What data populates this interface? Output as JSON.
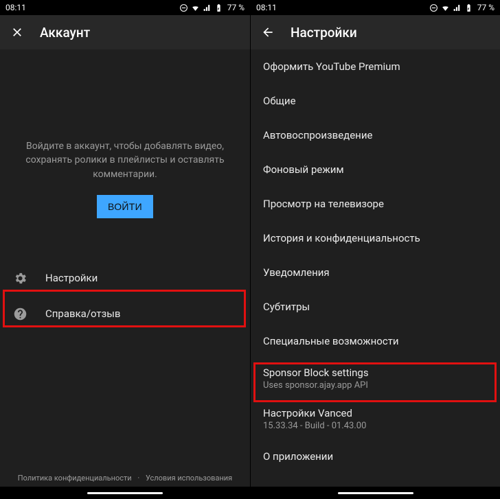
{
  "statusbar": {
    "time": "08:11",
    "battery_text": "77 %"
  },
  "left": {
    "title": "Аккаунт",
    "signin_text": "Войдите в аккаунт, чтобы добавлять видео, сохранять ролики в плейлисты и оставлять комментарии.",
    "signin_button": "ВОЙТИ",
    "items": [
      {
        "label": "Настройки"
      },
      {
        "label": "Справка/отзыв"
      }
    ],
    "footer": {
      "privacy": "Политика конфиденциальности",
      "sep": "·",
      "terms": "Условия использования"
    }
  },
  "right": {
    "title": "Настройки",
    "items": [
      {
        "label": "Оформить YouTube Premium"
      },
      {
        "label": "Общие"
      },
      {
        "label": "Автовоспроизведение"
      },
      {
        "label": "Фоновый режим"
      },
      {
        "label": "Просмотр на телевизоре"
      },
      {
        "label": "История и конфиденциальность"
      },
      {
        "label": "Уведомления"
      },
      {
        "label": "Субтитры"
      },
      {
        "label": "Специальные возможности"
      },
      {
        "label": "Sponsor Block settings",
        "sub": "Uses sponsor.ajay.app API"
      },
      {
        "label": "Настройки Vanced",
        "sub": "15.33.34 - Build - 01.43.00"
      },
      {
        "label": "О приложении"
      }
    ]
  }
}
